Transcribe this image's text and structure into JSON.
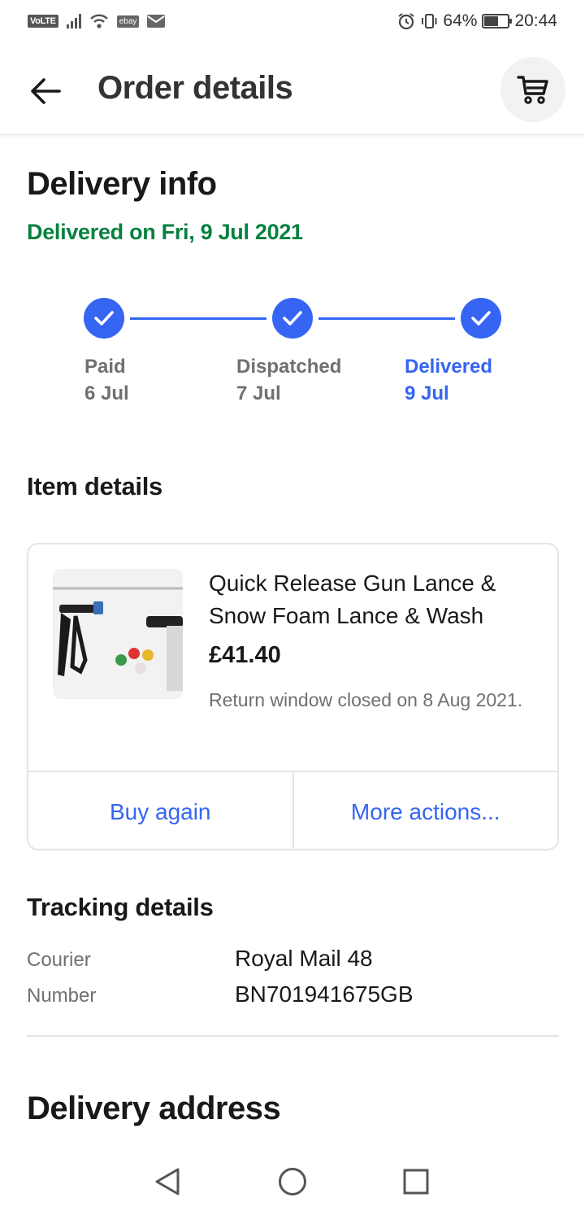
{
  "status_bar": {
    "volte": "VoLTE",
    "ebay_badge": "ebay",
    "battery_percent": "64%",
    "battery_level": 0.64,
    "time": "20:44"
  },
  "header": {
    "title": "Order details",
    "back_icon": "arrow-left-icon",
    "cart_icon": "cart-icon"
  },
  "delivery_info": {
    "title": "Delivery info",
    "status": "Delivered on Fri, 9 Jul 2021",
    "status_color": "#05823f",
    "steps": [
      {
        "label": "Paid",
        "date": "6 Jul",
        "active": false
      },
      {
        "label": "Dispatched",
        "date": "7 Jul",
        "active": false
      },
      {
        "label": "Delivered",
        "date": "9 Jul",
        "active": true
      }
    ],
    "accent_color": "#3665f3"
  },
  "item_details": {
    "title": "Item details",
    "item": {
      "title": "Quick Release Gun Lance & Snow Foam Lance & Wash",
      "price": "£41.40",
      "return_note": "Return window closed on 8 Aug 2021."
    },
    "actions": {
      "buy_again": "Buy again",
      "more_actions": "More actions..."
    }
  },
  "tracking_details": {
    "title": "Tracking details",
    "courier_label": "Courier",
    "courier_value": "Royal Mail 48",
    "number_label": "Number",
    "number_value": "BN701941675GB"
  },
  "delivery_address": {
    "title": "Delivery address"
  },
  "nav": {
    "back": "nav-back-icon",
    "home": "nav-home-icon",
    "recents": "nav-recents-icon"
  }
}
